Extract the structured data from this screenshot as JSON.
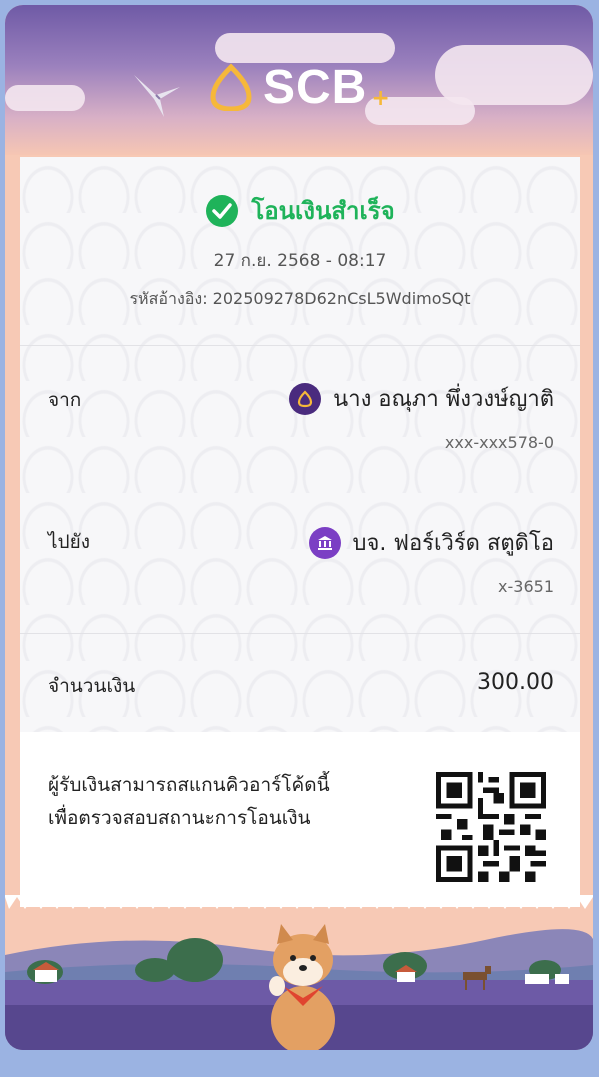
{
  "header": {
    "logo_text": "SCB",
    "logo_plus": "+"
  },
  "status": {
    "text": "โอนเงินสำเร็จ",
    "icon": "check-circle-icon",
    "color": "#1fb35a"
  },
  "datetime": "27 ก.ย. 2568 - 08:17",
  "reference": {
    "label": "รหัสอ้างอิง:",
    "value": "202509278D62nCsL5WdimoSQt"
  },
  "from": {
    "label": "จาก",
    "name": "นาง อณุภา พึ่งวงษ์ญาติ",
    "account": "xxx-xxx578-0",
    "icon": "scb-bank-icon"
  },
  "to": {
    "label": "ไปยัง",
    "name": "บจ. ฟอร์เวิร์ด สตูดิโอ",
    "account": "x-3651",
    "icon": "bank-building-icon"
  },
  "amount": {
    "label": "จำนวนเงิน",
    "value": "300.00"
  },
  "qr_note": {
    "line1": "ผู้รับเงินสามารถสแกนคิวอาร์โค้ดนี้",
    "line2": "เพื่อตรวจสอบสถานะการโอนเงิน"
  },
  "colors": {
    "brand_purple": "#4a2b7e",
    "accent_gold": "#f6b83a",
    "success_green": "#1fb35a",
    "background": "#9bb3e2"
  }
}
